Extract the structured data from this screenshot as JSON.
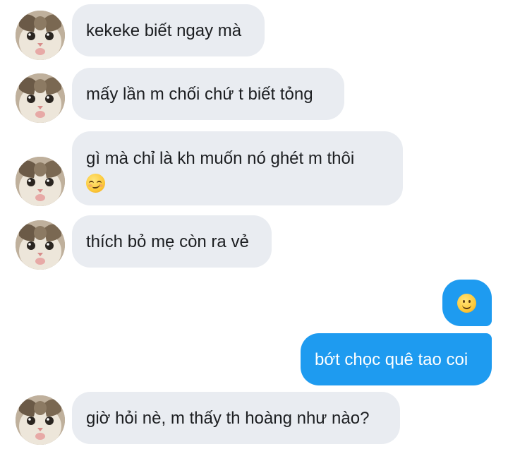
{
  "contact": {
    "avatar_icon": "cat-photo-avatar"
  },
  "messages": [
    {
      "direction": "incoming",
      "text": "kekeke biết ngay mà"
    },
    {
      "direction": "incoming",
      "text": "mấy lần m chối chứ t biết tỏng"
    },
    {
      "direction": "incoming",
      "text": "gì mà chỉ là kh muốn nó ghét m thôi",
      "emoji": "smirking-face"
    },
    {
      "direction": "incoming",
      "text": "thích bỏ mẹ còn ra vẻ"
    },
    {
      "direction": "outgoing",
      "emoji": "slightly-smiling-face"
    },
    {
      "direction": "outgoing",
      "text": "bớt chọc quê tao coi"
    },
    {
      "direction": "incoming",
      "text": "giờ hỏi nè, m thấy th hoàng như nào?"
    }
  ],
  "colors": {
    "incoming_bubble": "#e9ecf1",
    "outgoing_bubble": "#1e9bf0",
    "incoming_text": "#1c1e21",
    "outgoing_text": "#ffffff"
  }
}
